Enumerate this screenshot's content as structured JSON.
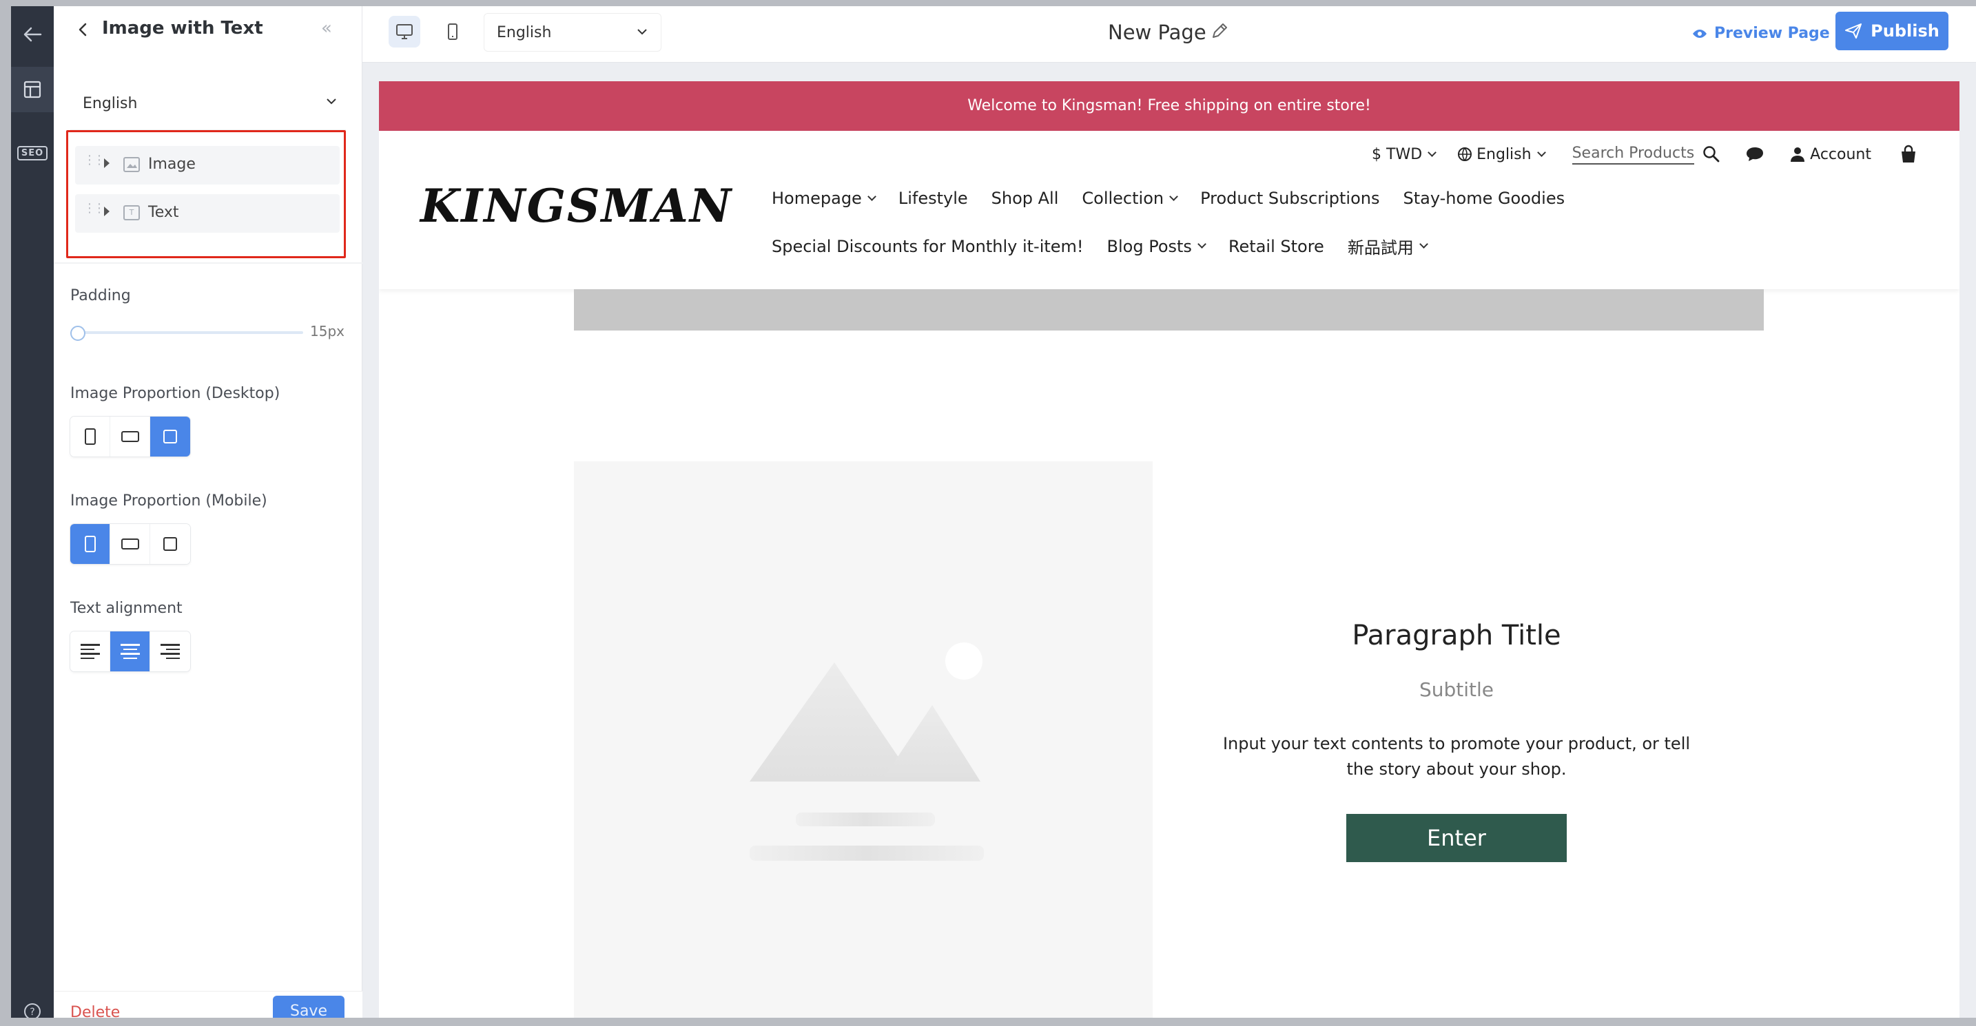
{
  "panel": {
    "title": "Image with Text",
    "language": "English",
    "tree": [
      {
        "label": "Image",
        "icon": "image-icon"
      },
      {
        "label": "Text",
        "icon": "text-block-icon"
      }
    ],
    "padding_label": "Padding",
    "padding_value": "15px",
    "image_proportion_desktop_label": "Image Proportion (Desktop)",
    "image_proportion_desktop_selected": "square",
    "image_proportion_mobile_label": "Image Proportion (Mobile)",
    "image_proportion_mobile_selected": "portrait",
    "text_alignment_label": "Text alignment",
    "text_alignment_selected": "center",
    "delete_label": "Delete",
    "save_label": "Save"
  },
  "toolbar": {
    "language": "English",
    "page_name": "New Page",
    "preview_label": "Preview Page",
    "publish_label": "Publish"
  },
  "site": {
    "announcement": "Welcome to Kingsman! Free shipping on entire store!",
    "logo": "KINGSMAN",
    "currency": "$ TWD",
    "language": "English",
    "search_placeholder": "Search Products",
    "account_label": "Account",
    "nav_row1": [
      {
        "label": "Homepage",
        "dropdown": true
      },
      {
        "label": "Lifestyle",
        "dropdown": false
      },
      {
        "label": "Shop All",
        "dropdown": false
      },
      {
        "label": "Collection",
        "dropdown": true
      },
      {
        "label": "Product Subscriptions",
        "dropdown": false
      },
      {
        "label": "Stay-home Goodies",
        "dropdown": false
      }
    ],
    "nav_row2": [
      {
        "label": "Special Discounts for Monthly it-item!",
        "dropdown": false
      },
      {
        "label": "Blog Posts",
        "dropdown": true
      },
      {
        "label": "Retail Store",
        "dropdown": false
      },
      {
        "label": "新品試用",
        "dropdown": true
      }
    ]
  },
  "section": {
    "title": "Paragraph Title",
    "subtitle": "Subtitle",
    "body": "Input your text contents to promote your product, or tell the story about your shop.",
    "button_label": "Enter"
  },
  "colors": {
    "accent": "#4a86e8",
    "announcement_bg": "#c84560",
    "enter_button_bg": "#2f5a4d",
    "highlight_border": "#e0281b"
  }
}
